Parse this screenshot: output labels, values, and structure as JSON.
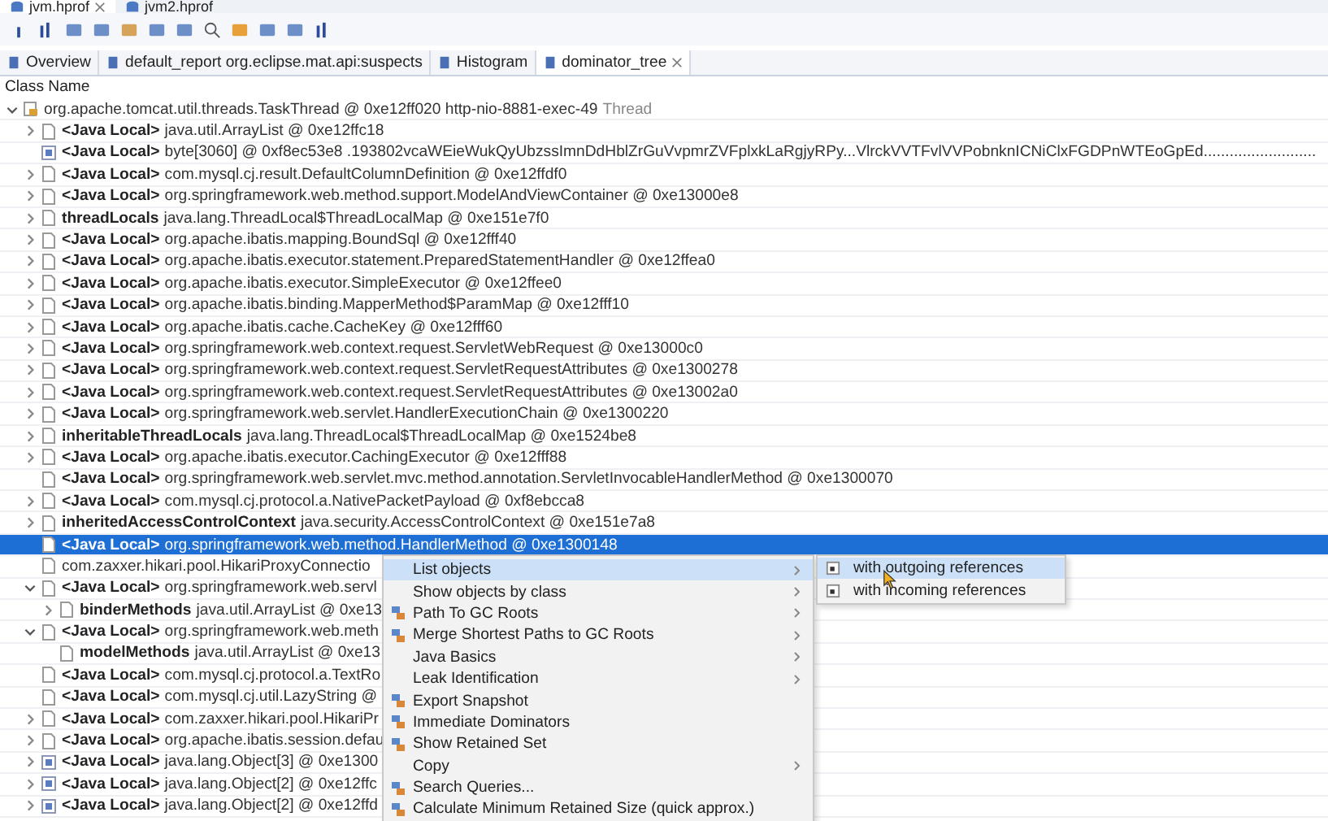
{
  "editor_tabs": [
    {
      "label": "jvm.hprof",
      "selected": true
    },
    {
      "label": "jvm2.hprof",
      "selected": false
    }
  ],
  "view_tabs": [
    {
      "label": "Overview",
      "selected": false
    },
    {
      "label": "default_report  org.eclipse.mat.api:suspects",
      "selected": false
    },
    {
      "label": "Histogram",
      "selected": false
    },
    {
      "label": "dominator_tree",
      "selected": true
    }
  ],
  "column_header": "Class Name",
  "tree": {
    "root": {
      "text": "org.apache.tomcat.util.threads.TaskThread @ 0xe12ff020  http-nio-8881-exec-49",
      "suffix": "Thread",
      "expanded": true,
      "kind": "thread",
      "selected": false,
      "children": [
        {
          "label": "<Java Local>",
          "text": "java.util.ArrayList @ 0xe12ffc18",
          "expanded": false,
          "kind": "object",
          "selected": false
        },
        {
          "label": "<Java Local>",
          "text": "byte[3060] @ 0xf8ec53e8  .193802vcaWEieWukQyUbzssImnDdHblZrGuVvpmrZVFplxkLaRgjyRPy...VlrckVVTFvlVVPobnknICNiClxFGDPnWTEoGpEd..........................",
          "kind": "array",
          "selected": false
        },
        {
          "label": "<Java Local>",
          "text": "com.mysql.cj.result.DefaultColumnDefinition @ 0xe12ffdf0",
          "expanded": false,
          "kind": "object",
          "selected": false
        },
        {
          "label": "<Java Local>",
          "text": "org.springframework.web.method.support.ModelAndViewContainer @ 0xe13000e8",
          "expanded": false,
          "kind": "object",
          "selected": false
        },
        {
          "label": "threadLocals",
          "text": "java.lang.ThreadLocal$ThreadLocalMap @ 0xe151e7f0",
          "expanded": false,
          "kind": "object",
          "selected": false
        },
        {
          "label": "<Java Local>",
          "text": "org.apache.ibatis.mapping.BoundSql @ 0xe12fff40",
          "expanded": false,
          "kind": "object",
          "selected": false
        },
        {
          "label": "<Java Local>",
          "text": "org.apache.ibatis.executor.statement.PreparedStatementHandler @ 0xe12ffea0",
          "expanded": false,
          "kind": "object",
          "selected": false
        },
        {
          "label": "<Java Local>",
          "text": "org.apache.ibatis.executor.SimpleExecutor @ 0xe12ffee0",
          "expanded": false,
          "kind": "object",
          "selected": false
        },
        {
          "label": "<Java Local>",
          "text": "org.apache.ibatis.binding.MapperMethod$ParamMap @ 0xe12fff10",
          "expanded": false,
          "kind": "object",
          "selected": false
        },
        {
          "label": "<Java Local>",
          "text": "org.apache.ibatis.cache.CacheKey @ 0xe12fff60",
          "expanded": false,
          "kind": "object",
          "selected": false
        },
        {
          "label": "<Java Local>",
          "text": "org.springframework.web.context.request.ServletWebRequest @ 0xe13000c0",
          "expanded": false,
          "kind": "object",
          "selected": false
        },
        {
          "label": "<Java Local>",
          "text": "org.springframework.web.context.request.ServletRequestAttributes @ 0xe1300278",
          "expanded": false,
          "kind": "object",
          "selected": false
        },
        {
          "label": "<Java Local>",
          "text": "org.springframework.web.context.request.ServletRequestAttributes @ 0xe13002a0",
          "expanded": false,
          "kind": "object",
          "selected": false
        },
        {
          "label": "<Java Local>",
          "text": "org.springframework.web.servlet.HandlerExecutionChain @ 0xe1300220",
          "expanded": false,
          "kind": "object",
          "selected": false
        },
        {
          "label": "inheritableThreadLocals",
          "text": "java.lang.ThreadLocal$ThreadLocalMap @ 0xe1524be8",
          "expanded": false,
          "kind": "object",
          "selected": false
        },
        {
          "label": "<Java Local>",
          "text": "org.apache.ibatis.executor.CachingExecutor @ 0xe12fff88",
          "expanded": false,
          "kind": "object",
          "selected": false
        },
        {
          "label": "<Java Local>",
          "text": "org.springframework.web.servlet.mvc.method.annotation.ServletInvocableHandlerMethod @ 0xe1300070",
          "kind": "object",
          "selected": false
        },
        {
          "label": "<Java Local>",
          "text": "com.mysql.cj.protocol.a.NativePacketPayload @ 0xf8ebcca8",
          "expanded": false,
          "kind": "object",
          "selected": false
        },
        {
          "label": "inheritedAccessControlContext",
          "text": "java.security.AccessControlContext @ 0xe151e7a8",
          "expanded": false,
          "kind": "object",
          "selected": false
        },
        {
          "label": "<Java Local>",
          "text": "org.springframework.web.method.HandlerMethod @ 0xe1300148",
          "kind": "object",
          "selected": true
        },
        {
          "text": "com.zaxxer.hikari.pool.HikariProxyConnectio",
          "kind": "object",
          "selected": false
        },
        {
          "label": "<Java Local>",
          "text": "org.springframework.web.servl",
          "expanded": true,
          "kind": "object",
          "selected": false,
          "children": [
            {
              "label": "binderMethods",
              "text": "java.util.ArrayList @ 0xe13",
              "expanded": false,
              "kind": "object",
              "selected": false
            }
          ]
        },
        {
          "label": "<Java Local>",
          "text": "org.springframework.web.meth",
          "expanded": true,
          "kind": "object",
          "selected": false,
          "children": [
            {
              "label": "modelMethods",
              "text": "java.util.ArrayList @ 0xe13",
              "kind": "object",
              "selected": false
            }
          ]
        },
        {
          "label": "<Java Local>",
          "text": "com.mysql.cj.protocol.a.TextRo",
          "kind": "object",
          "selected": false
        },
        {
          "label": "<Java Local>",
          "text": "com.mysql.cj.util.LazyString @",
          "kind": "object",
          "selected": false
        },
        {
          "label": "<Java Local>",
          "text": "com.zaxxer.hikari.pool.HikariPr",
          "expanded": false,
          "kind": "object",
          "selected": false
        },
        {
          "label": "<Java Local>",
          "text": "org.apache.ibatis.session.defau",
          "expanded": false,
          "kind": "object",
          "selected": false
        },
        {
          "label": "<Java Local>",
          "text": "java.lang.Object[3] @ 0xe1300",
          "expanded": false,
          "kind": "array",
          "selected": false
        },
        {
          "label": "<Java Local>",
          "text": "java.lang.Object[2] @ 0xe12ffc",
          "expanded": false,
          "kind": "array",
          "selected": false
        },
        {
          "label": "<Java Local>",
          "text": "java.lang.Object[2] @ 0xe12ffd",
          "expanded": false,
          "kind": "array",
          "selected": false
        }
      ]
    }
  },
  "context_menu": {
    "items": [
      {
        "label": "List objects",
        "kind": "plain",
        "submenu": true,
        "selected": true
      },
      {
        "label": "Show objects by class",
        "kind": "plain",
        "submenu": true,
        "selected": false
      },
      {
        "label": "Path To GC Roots",
        "kind": "icon",
        "submenu": true,
        "selected": false
      },
      {
        "label": "Merge Shortest Paths to GC Roots",
        "kind": "icon",
        "submenu": true,
        "selected": false
      },
      {
        "label": "Java Basics",
        "kind": "plain",
        "submenu": true,
        "selected": false
      },
      {
        "label": "Leak Identification",
        "kind": "plain",
        "submenu": true,
        "selected": false
      },
      {
        "label": "Export Snapshot",
        "kind": "icon",
        "submenu": false,
        "selected": false
      },
      {
        "label": "Immediate Dominators",
        "kind": "icon",
        "submenu": false,
        "selected": false
      },
      {
        "label": "Show Retained Set",
        "kind": "icon",
        "submenu": false,
        "selected": false
      },
      {
        "label": "Copy",
        "kind": "plain",
        "submenu": true,
        "selected": false
      },
      {
        "label": "Search Queries...",
        "kind": "icon",
        "submenu": false,
        "selected": false
      },
      {
        "label": "Calculate Minimum Retained Size (quick approx.)",
        "kind": "icon",
        "submenu": false,
        "selected": false
      }
    ]
  },
  "submenu": {
    "items": [
      {
        "label": "with outgoing references",
        "selected": true
      },
      {
        "label": "with incoming references",
        "selected": false
      }
    ]
  }
}
